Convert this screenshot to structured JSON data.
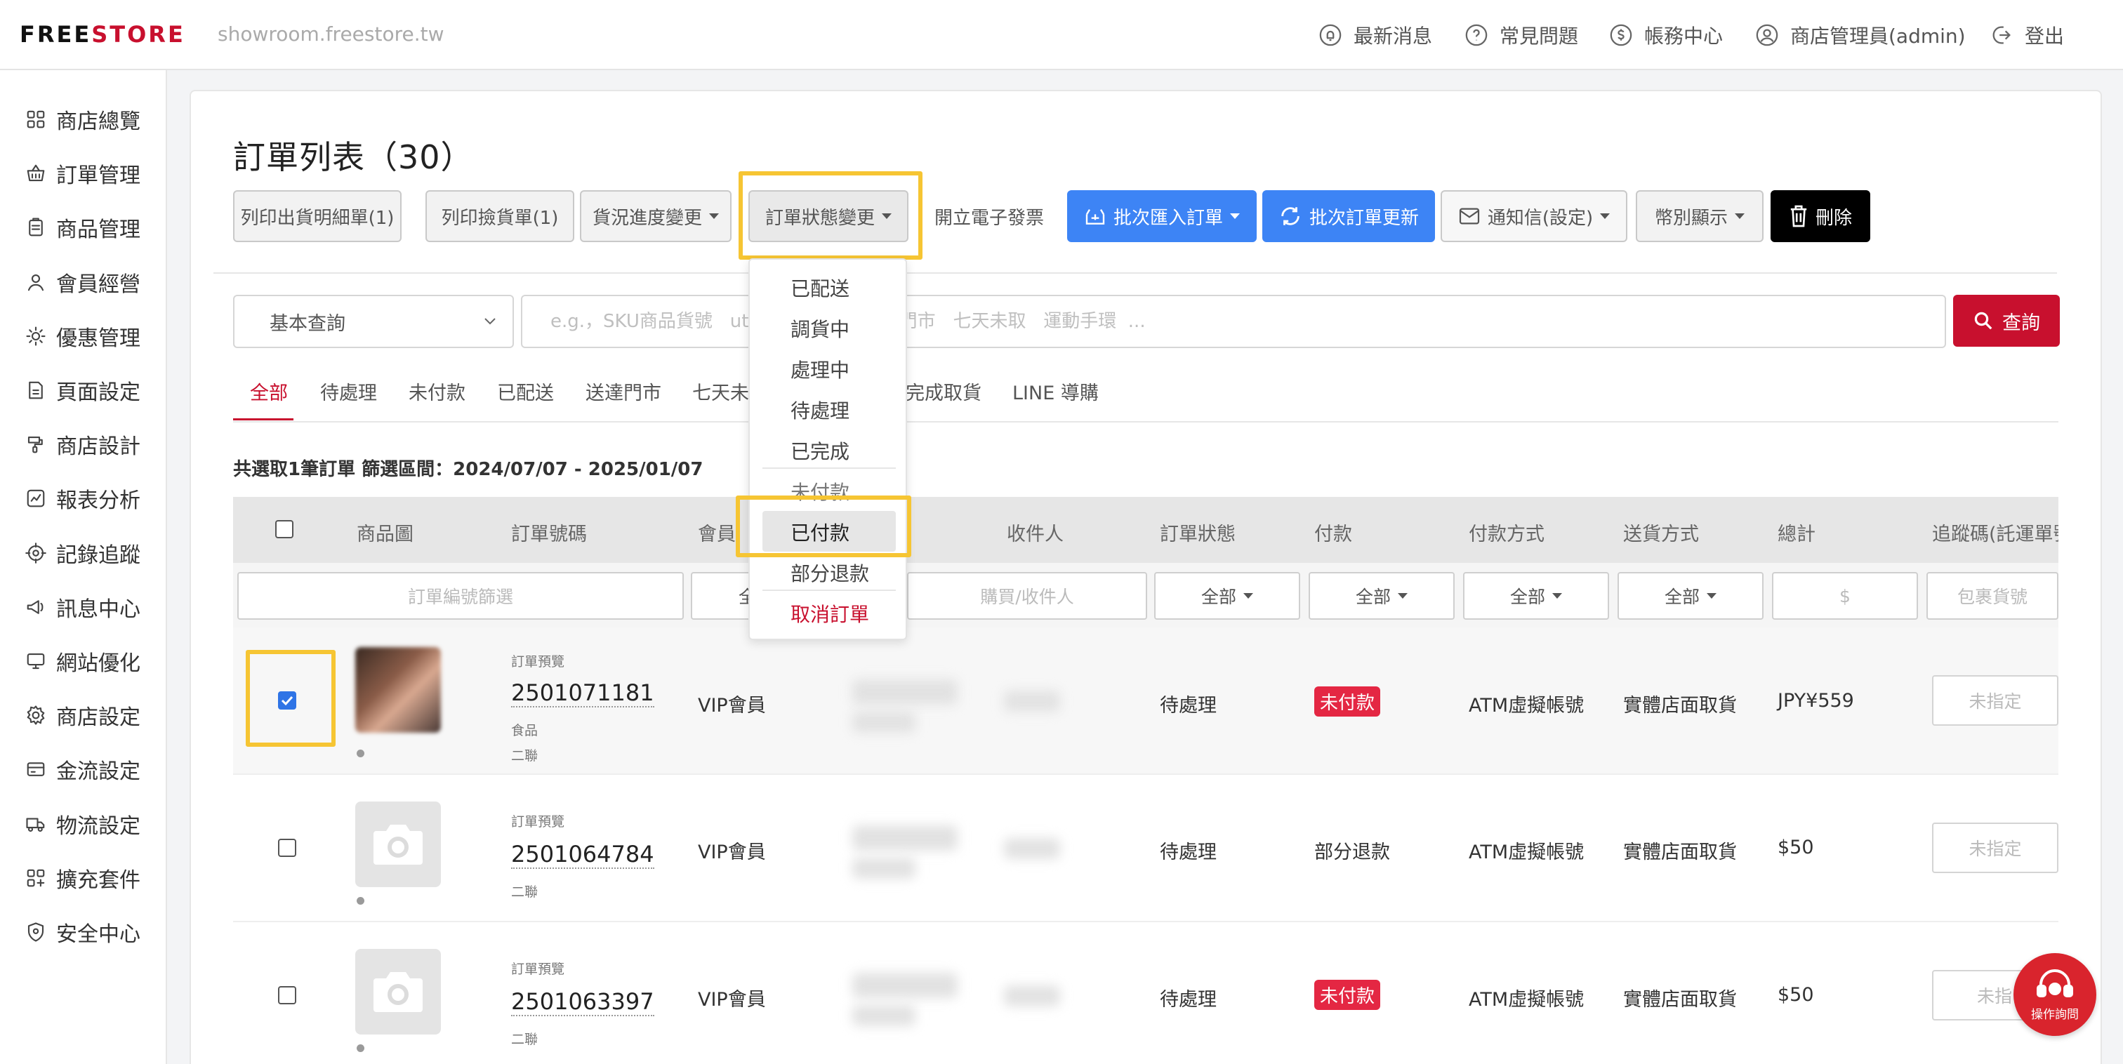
{
  "brand": {
    "logo_a": "FREE",
    "logo_b": "STORE",
    "domain": "showroom.freestore.tw"
  },
  "topnav": {
    "news": "最新消息",
    "faq": "常見問題",
    "billing": "帳務中心",
    "admin": "商店管理員(admin)",
    "logout": "登出"
  },
  "sidebar": {
    "items": [
      {
        "label": "商店總覽",
        "icon": "grid-icon"
      },
      {
        "label": "訂單管理",
        "icon": "basket-icon"
      },
      {
        "label": "商品管理",
        "icon": "clipboard-icon"
      },
      {
        "label": "會員經營",
        "icon": "user-icon"
      },
      {
        "label": "優惠管理",
        "icon": "tag-gear-icon"
      },
      {
        "label": "頁面設定",
        "icon": "page-icon"
      },
      {
        "label": "商店設計",
        "icon": "brush-icon"
      },
      {
        "label": "報表分析",
        "icon": "chart-icon"
      },
      {
        "label": "記錄追蹤",
        "icon": "target-icon"
      },
      {
        "label": "訊息中心",
        "icon": "megaphone-icon"
      },
      {
        "label": "網站優化",
        "icon": "monitor-icon"
      },
      {
        "label": "商店設定",
        "icon": "gear-icon"
      },
      {
        "label": "金流設定",
        "icon": "card-icon"
      },
      {
        "label": "物流設定",
        "icon": "truck-icon"
      },
      {
        "label": "擴充套件",
        "icon": "plugin-icon"
      },
      {
        "label": "安全中心",
        "icon": "shield-icon"
      }
    ]
  },
  "page": {
    "title": "訂單列表（30）"
  },
  "toolbar": {
    "print_detail": "列印出貨明細單(1)",
    "print_picking": "列印撿貨單(1)",
    "shipping_progress": "貨況進度變更",
    "order_status": "訂單狀態變更",
    "einvoice": "開立電子發票",
    "batch_import": "批次匯入訂單",
    "batch_update": "批次訂單更新",
    "notify": "通知信(設定)",
    "currency": "幣別顯示",
    "delete": "刪除"
  },
  "search": {
    "mode": "基本查詢",
    "placeholder": "e.g.，SKU商品貨號   utm_               送達門市   七天未取   運動手環  ...",
    "button": "查詢"
  },
  "tabs": [
    "全部",
    "待處理",
    "未付款",
    "已配送",
    "送達門市",
    "七天未",
    "完成取貨",
    "LINE 導購"
  ],
  "summary": "共選取1筆訂單 篩選區間：2024/07/07 - 2025/01/07",
  "table": {
    "headers": {
      "image": "商品圖",
      "order_no": "訂單號碼",
      "member": "會員",
      "recipient": "收件人",
      "status": "訂單狀態",
      "payment": "付款",
      "pay_method": "付款方式",
      "delivery": "送貨方式",
      "total": "總計",
      "tracking": "追蹤碼(託運單號"
    },
    "filters": {
      "order_no": "訂單編號篩選",
      "member": "全",
      "buyer": "購買/收件人",
      "status": "全部",
      "payment": "全部",
      "pay_method": "全部",
      "delivery": "全部",
      "total": "$",
      "tracking": "包裹貨號"
    },
    "rows": [
      {
        "checked": true,
        "tag": "訂單預覽",
        "order_no": "2501071181",
        "sub": "食品",
        "copy": "二聯",
        "member": "VIP會員",
        "status": "待處理",
        "payment": "未付款",
        "payment_badge": true,
        "pay_method": "ATM虛擬帳號",
        "delivery": "實體店面取貨",
        "total": "JPY¥559",
        "tracking": "未指定"
      },
      {
        "checked": false,
        "tag": "訂單預覽",
        "order_no": "2501064784",
        "sub": "",
        "copy": "二聯",
        "member": "VIP會員",
        "status": "待處理",
        "payment": "部分退款",
        "payment_badge": false,
        "pay_method": "ATM虛擬帳號",
        "delivery": "實體店面取貨",
        "total": "$50",
        "tracking": "未指定"
      },
      {
        "checked": false,
        "tag": "訂單預覽",
        "order_no": "2501063397",
        "sub": "",
        "copy": "二聯",
        "member": "VIP會員",
        "status": "待處理",
        "payment": "未付款",
        "payment_badge": true,
        "pay_method": "ATM虛擬帳號",
        "delivery": "實體店面取貨",
        "total": "$50",
        "tracking": "未指"
      }
    ]
  },
  "dropdown": {
    "items": [
      "已配送",
      "調貨中",
      "處理中",
      "待處理",
      "已完成",
      "未付款",
      "已付款",
      "部分退款",
      "取消訂單"
    ],
    "selected": "已付款"
  },
  "help": {
    "label": "操作詢問"
  },
  "colors": {
    "accent": "#c8102e",
    "blue": "#3d84f5",
    "highlight": "#f6c533",
    "badge": "#e42743"
  }
}
